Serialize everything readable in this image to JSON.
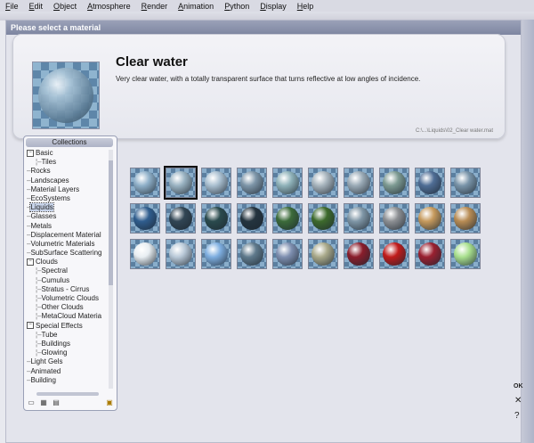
{
  "menu": [
    "File",
    "Edit",
    "Object",
    "Atmosphere",
    "Render",
    "Animation",
    "Python",
    "Display",
    "Help"
  ],
  "dialog": {
    "title": "Please select a material"
  },
  "material": {
    "name": "Clear water",
    "description": "Very clear water, with a totally transparent surface that turns reflective at low angles of incidence.",
    "path": "C:\\...\\Liquids\\02_Clear water.mat"
  },
  "collections": {
    "title": "Collections",
    "items": [
      {
        "label": "Basic",
        "level": 0,
        "expander": "−"
      },
      {
        "label": "Tiles",
        "level": 1
      },
      {
        "label": "Rocks",
        "level": 0
      },
      {
        "label": "Landscapes",
        "level": 0
      },
      {
        "label": "Material Layers",
        "level": 0
      },
      {
        "label": "EcoSystems",
        "level": 0
      },
      {
        "label": "Liquids",
        "level": 0,
        "selected": true
      },
      {
        "label": "Glasses",
        "level": 0
      },
      {
        "label": "Metals",
        "level": 0
      },
      {
        "label": "Displacement Material",
        "level": 0
      },
      {
        "label": "Volumetric Materials",
        "level": 0
      },
      {
        "label": "SubSurface Scattering",
        "level": 0
      },
      {
        "label": "Clouds",
        "level": 0,
        "expander": "−"
      },
      {
        "label": "Spectral",
        "level": 1
      },
      {
        "label": "Cumulus",
        "level": 1
      },
      {
        "label": "Stratus - Cirrus",
        "level": 1
      },
      {
        "label": "Volumetric Clouds",
        "level": 1
      },
      {
        "label": "Other Clouds",
        "level": 1
      },
      {
        "label": "MetaCloud Materia",
        "level": 1
      },
      {
        "label": "Special Effects",
        "level": 0,
        "expander": "−"
      },
      {
        "label": "Tube",
        "level": 1
      },
      {
        "label": "Buildings",
        "level": 1
      },
      {
        "label": "Glowing",
        "level": 1
      },
      {
        "label": "Light Gels",
        "level": 0
      },
      {
        "label": "Animated",
        "level": 0
      },
      {
        "label": "Building",
        "level": 0
      }
    ]
  },
  "thumbnails": [
    [
      "#8fb0c9",
      "#9ab3c2",
      "#a9bfd0",
      "#7d95a8",
      "#8fb2b9",
      "#a7b4bd",
      "#9aaab6",
      "#7d9a92",
      "#4f6d95",
      "#7994a9"
    ],
    [
      "#2f5d8e",
      "#314554",
      "#2a4a4d",
      "#24343f",
      "#3c6b3a",
      "#3d6a2c",
      "#7f96a6",
      "#8c8f93",
      "#c69a5d",
      "#b88c54"
    ],
    [
      "#e8eef2",
      "#b9c9d8",
      "#7eaee0",
      "#5f7a8c",
      "#7e8fb0",
      "#a9a98a",
      "#8a1d2b",
      "#c01b1b",
      "#9a2030",
      "#a9e08e"
    ]
  ],
  "side": {
    "ok": "OK",
    "close": "✕",
    "help": "?"
  }
}
